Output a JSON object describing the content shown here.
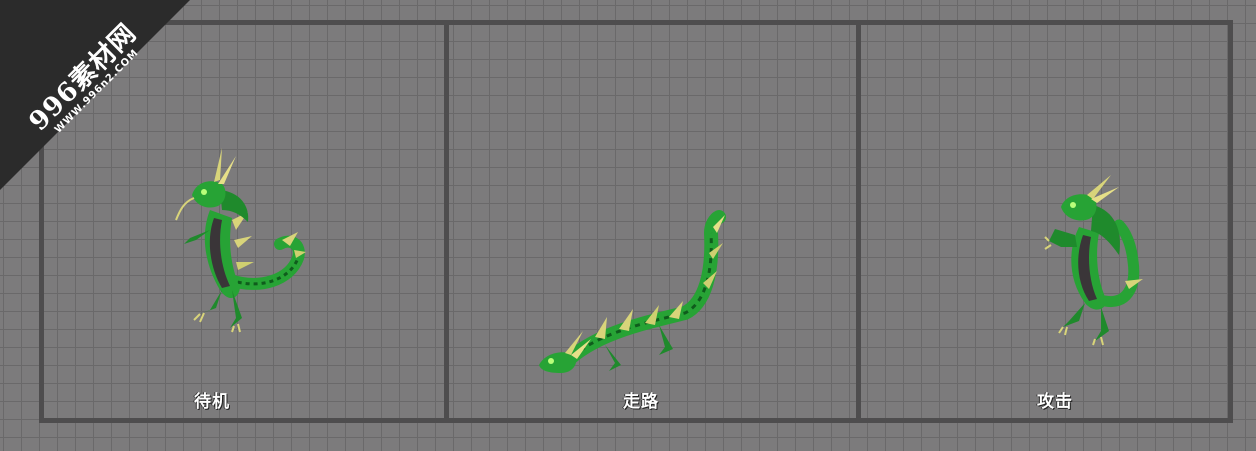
{
  "watermark": {
    "brand": "996素材网",
    "url": "WWW.996n2.COM"
  },
  "panels": [
    {
      "label": "待机",
      "dragon_icon": "green-dragon-idle-sprite"
    },
    {
      "label": "走路",
      "dragon_icon": "green-dragon-walk-sprite"
    },
    {
      "label": "攻击",
      "dragon_icon": "green-dragon-attack-sprite"
    }
  ],
  "colors": {
    "background": "#7c7b7c",
    "grid_line": "#6a696a",
    "frame": "#4e4d4e",
    "dragon_green": "#27a335",
    "dragon_dark_green": "#0f5c1c",
    "dragon_belly": "#3a3538",
    "dragon_horn": "#d8d47a",
    "label_text": "#ffffff",
    "watermark_bg": "#2b2b2b"
  }
}
